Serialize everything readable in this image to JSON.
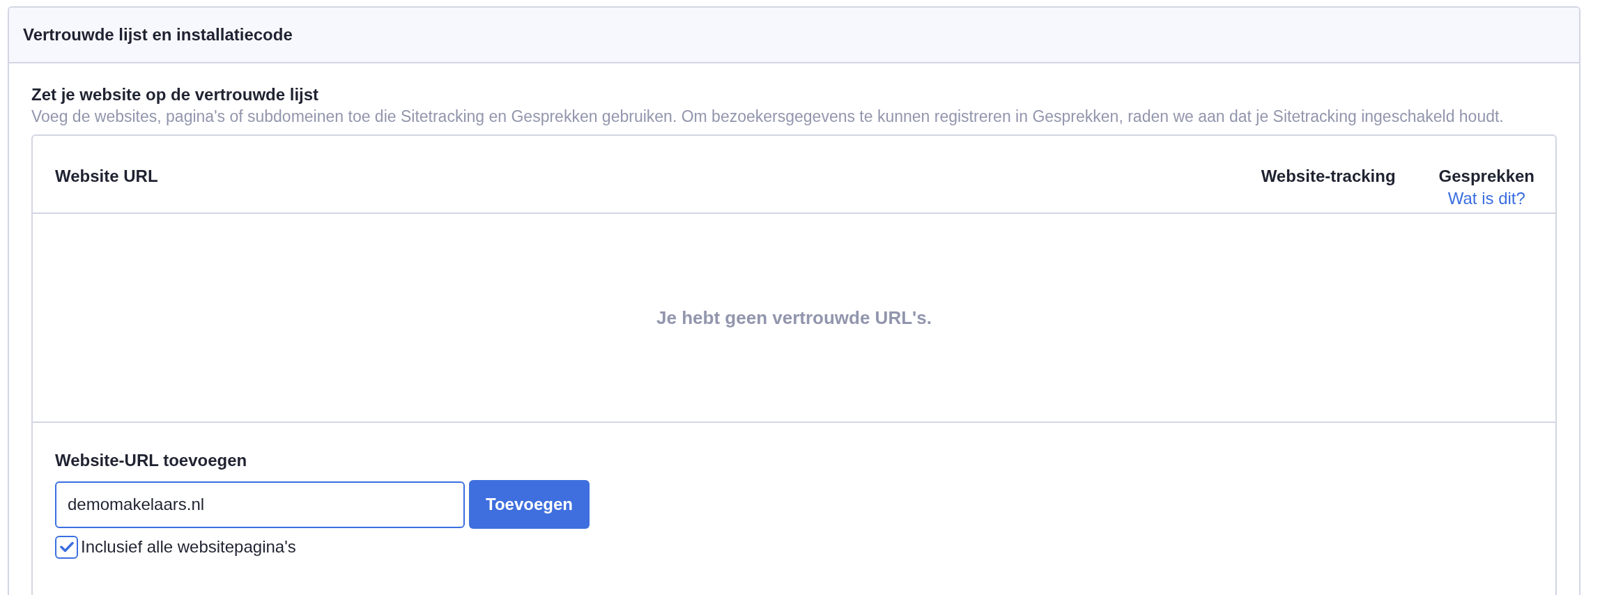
{
  "panel": {
    "title": "Vertrouwde lijst en installatiecode"
  },
  "section": {
    "heading": "Zet je website op de vertrouwde lijst",
    "description": "Voeg de websites, pagina's of subdomeinen toe die Sitetracking en Gesprekken gebruiken. Om bezoekersgegevens te kunnen registreren in Gesprekken, raden we aan dat je Sitetracking ingeschakeld houdt."
  },
  "table": {
    "columns": [
      {
        "label": "Website URL"
      },
      {
        "label": "Website-tracking"
      },
      {
        "label": "Gesprekken",
        "link": "Wat is dit?"
      }
    ],
    "empty_message": "Je hebt geen vertrouwde URL's."
  },
  "add_form": {
    "label": "Website-URL toevoegen",
    "input_value": "demomakelaars.nl",
    "button": "Toevoegen",
    "checkbox": {
      "label": "Inclusief alle websitepagina's",
      "checked": true
    }
  }
}
